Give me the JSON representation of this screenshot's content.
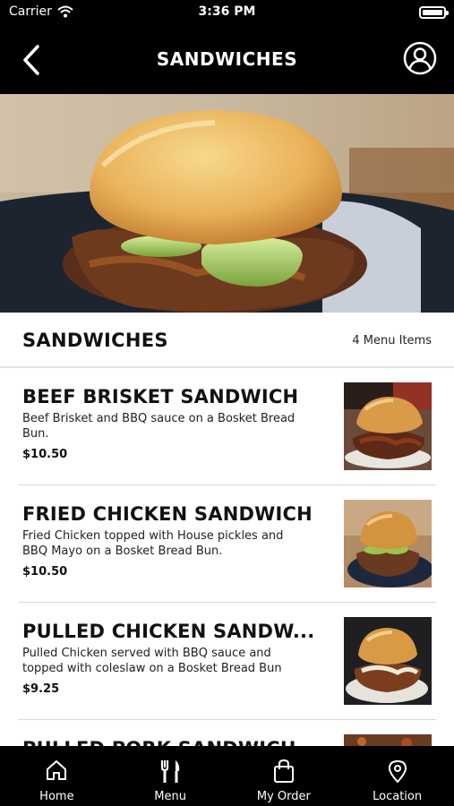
{
  "status_bar": {
    "carrier": "Carrier",
    "time": "3:36 PM",
    "wifi_icon": "wifi-icon",
    "battery_icon": "battery-icon"
  },
  "nav": {
    "title": "SANDWICHES",
    "back_icon": "chevron-left-icon",
    "profile_icon": "user-circle-icon"
  },
  "section": {
    "title": "SANDWICHES",
    "count_label": "4 Menu Items"
  },
  "items": [
    {
      "name": "BEEF BRISKET SANDWICH",
      "description": "Beef Brisket and BBQ sauce on a Bosket Bread Bun.",
      "price": "$10.50"
    },
    {
      "name": "FRIED CHICKEN SANDWICH",
      "description": "Fried Chicken topped with House pickles and BBQ Mayo on a Bosket Bread Bun.",
      "price": "$10.50"
    },
    {
      "name": "PULLED CHICKEN SANDW...",
      "description": "Pulled Chicken served with BBQ sauce and topped with coleslaw on a Bosket Bread Bun (s...",
      "price": "$9.25"
    },
    {
      "name": "PULLED PORK SANDWICH",
      "description": "",
      "price": ""
    }
  ],
  "tabs": [
    {
      "label": "Home",
      "icon": "home-icon"
    },
    {
      "label": "Menu",
      "icon": "fork-knife-icon"
    },
    {
      "label": "My Order",
      "icon": "shopping-bag-icon"
    },
    {
      "label": "Location",
      "icon": "map-pin-icon"
    }
  ],
  "colors": {
    "bar_background": "#000000",
    "text_primary": "#111111",
    "separator": "#d9d9d9"
  }
}
